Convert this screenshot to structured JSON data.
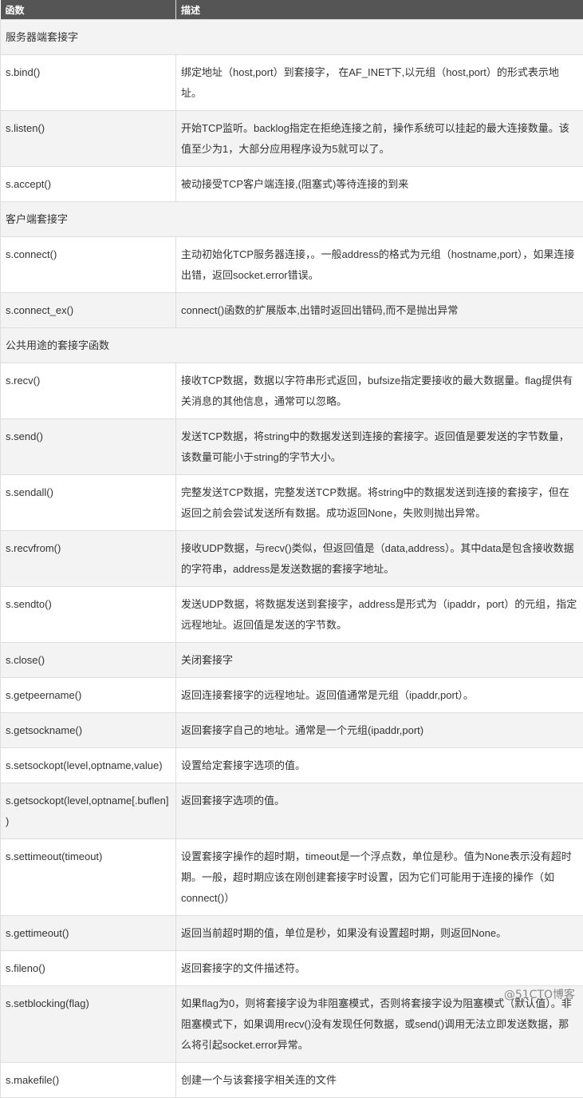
{
  "header": {
    "col1": "函数",
    "col2": "描述"
  },
  "sections": {
    "server": "服务器端套接字",
    "client": "客户端套接字",
    "common": "公共用途的套接字函数"
  },
  "rows": [
    {
      "fn": "s.bind()",
      "desc": "绑定地址（host,port）到套接字， 在AF_INET下,以元组（host,port）的形式表示地址。"
    },
    {
      "fn": "s.listen()",
      "desc": "开始TCP监听。backlog指定在拒绝连接之前，操作系统可以挂起的最大连接数量。该值至少为1，大部分应用程序设为5就可以了。"
    },
    {
      "fn": "s.accept()",
      "desc": "被动接受TCP客户端连接,(阻塞式)等待连接的到来"
    },
    {
      "fn": "s.connect()",
      "desc": "主动初始化TCP服务器连接，。一般address的格式为元组（hostname,port），如果连接出错，返回socket.error错误。"
    },
    {
      "fn": "s.connect_ex()",
      "desc": "connect()函数的扩展版本,出错时返回出错码,而不是抛出异常"
    },
    {
      "fn": "s.recv()",
      "desc": "接收TCP数据，数据以字符串形式返回，bufsize指定要接收的最大数据量。flag提供有关消息的其他信息，通常可以忽略。"
    },
    {
      "fn": "s.send()",
      "desc": "发送TCP数据，将string中的数据发送到连接的套接字。返回值是要发送的字节数量，该数量可能小于string的字节大小。"
    },
    {
      "fn": "s.sendall()",
      "desc": "完整发送TCP数据，完整发送TCP数据。将string中的数据发送到连接的套接字，但在返回之前会尝试发送所有数据。成功返回None，失败则抛出异常。"
    },
    {
      "fn": "s.recvfrom()",
      "desc": "接收UDP数据，与recv()类似，但返回值是（data,address）。其中data是包含接收数据的字符串，address是发送数据的套接字地址。"
    },
    {
      "fn": "s.sendto()",
      "desc": "发送UDP数据，将数据发送到套接字，address是形式为（ipaddr，port）的元组，指定远程地址。返回值是发送的字节数。"
    },
    {
      "fn": "s.close()",
      "desc": "关闭套接字"
    },
    {
      "fn": "s.getpeername()",
      "desc": "返回连接套接字的远程地址。返回值通常是元组（ipaddr,port）。"
    },
    {
      "fn": "s.getsockname()",
      "desc": "返回套接字自己的地址。通常是一个元组(ipaddr,port)"
    },
    {
      "fn": "s.setsockopt(level,optname,value)",
      "desc": "设置给定套接字选项的值。"
    },
    {
      "fn": "s.getsockopt(level,optname[.buflen])",
      "desc": "返回套接字选项的值。"
    },
    {
      "fn": "s.settimeout(timeout)",
      "desc": "设置套接字操作的超时期，timeout是一个浮点数，单位是秒。值为None表示没有超时期。一般，超时期应该在刚创建套接字时设置，因为它们可能用于连接的操作（如 connect()）"
    },
    {
      "fn": "s.gettimeout()",
      "desc": "返回当前超时期的值，单位是秒，如果没有设置超时期，则返回None。"
    },
    {
      "fn": "s.fileno()",
      "desc": "返回套接字的文件描述符。"
    },
    {
      "fn": "s.setblocking(flag)",
      "desc": "如果flag为0，则将套接字设为非阻塞模式，否则将套接字设为阻塞模式（默认值）。非阻塞模式下，如果调用recv()没有发现任何数据，或send()调用无法立即发送数据，那么将引起socket.error异常。"
    },
    {
      "fn": "s.makefile()",
      "desc": "创建一个与该套接字相关连的文件"
    }
  ],
  "watermark": "@51CTO博客"
}
